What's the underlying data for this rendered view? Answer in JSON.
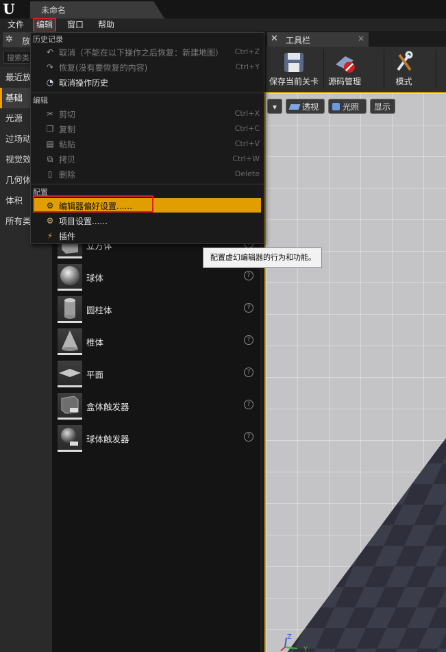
{
  "window": {
    "logo_icon": "unreal-logo-icon",
    "logo_text": "U",
    "document_tab": "未命名"
  },
  "menubar": {
    "file": "文件",
    "edit": "编辑",
    "window": "窗口",
    "help": "帮助"
  },
  "left_panel": {
    "tab_label": "放",
    "search_placeholder": "搜索类",
    "categories": [
      "最近放",
      "基础",
      "光源",
      "过场动",
      "视觉效",
      "几何体",
      "体积",
      "所有类"
    ],
    "selected_category": "基础",
    "items": [
      {
        "name": "立方体",
        "icon": "cube-icon"
      },
      {
        "name": "球体",
        "icon": "sphere-icon"
      },
      {
        "name": "圆柱体",
        "icon": "cylinder-icon"
      },
      {
        "name": "椎体",
        "icon": "cone-icon"
      },
      {
        "name": "平面",
        "icon": "plane-icon"
      },
      {
        "name": "盒体触发器",
        "icon": "box-trigger-icon"
      },
      {
        "name": "球体触发器",
        "icon": "sphere-trigger-icon"
      }
    ],
    "help_glyph": "?"
  },
  "toolbar": {
    "tab_label": "工具栏",
    "close": "×",
    "buttons": [
      {
        "label": "保存当前关卡",
        "icon": "save-icon"
      },
      {
        "label": "源码管理",
        "icon": "source-control-icon"
      },
      {
        "label": "模式",
        "icon": "modes-icon"
      }
    ]
  },
  "viewport": {
    "dropdown": "▾",
    "perspective": "透视",
    "lighting": "光照",
    "show": "显示",
    "axis_z": "Z",
    "axis_y": "Y"
  },
  "edit_menu": {
    "sections": [
      {
        "header": "历史记录",
        "items": [
          {
            "label": "取消（不能在以下操作之后恢复：新建地图）",
            "shortcut": "Ctrl+Z",
            "icon": "undo-icon",
            "enabled": false
          },
          {
            "label": "恢复(没有要恢复的内容)",
            "shortcut": "Ctrl+Y",
            "icon": "redo-icon",
            "enabled": false
          },
          {
            "label": "取消操作历史",
            "shortcut": "",
            "icon": "history-icon",
            "enabled": true
          }
        ]
      },
      {
        "header": "编辑",
        "items": [
          {
            "label": "剪切",
            "shortcut": "Ctrl+X",
            "icon": "cut-icon",
            "enabled": false
          },
          {
            "label": "复制",
            "shortcut": "Ctrl+C",
            "icon": "copy-icon",
            "enabled": false
          },
          {
            "label": "粘贴",
            "shortcut": "Ctrl+V",
            "icon": "paste-icon",
            "enabled": false
          },
          {
            "label": "拷贝",
            "shortcut": "Ctrl+W",
            "icon": "duplicate-icon",
            "enabled": false
          },
          {
            "label": "删除",
            "shortcut": "Delete",
            "icon": "delete-icon",
            "enabled": false
          }
        ]
      },
      {
        "header": "配置",
        "items": [
          {
            "label": "编辑器偏好设置......",
            "shortcut": "",
            "icon": "editor-preferences-icon",
            "enabled": true,
            "highlighted": true
          },
          {
            "label": "项目设置......",
            "shortcut": "",
            "icon": "project-settings-icon",
            "enabled": true
          },
          {
            "label": "插件",
            "shortcut": "",
            "icon": "plugins-icon",
            "enabled": true
          }
        ]
      }
    ]
  },
  "tooltip": "配置虚幻编辑器的行为和功能。",
  "colors": {
    "highlight": "#e09e00",
    "annotation_red": "#e02020",
    "viewport_border": "#d6a000"
  }
}
